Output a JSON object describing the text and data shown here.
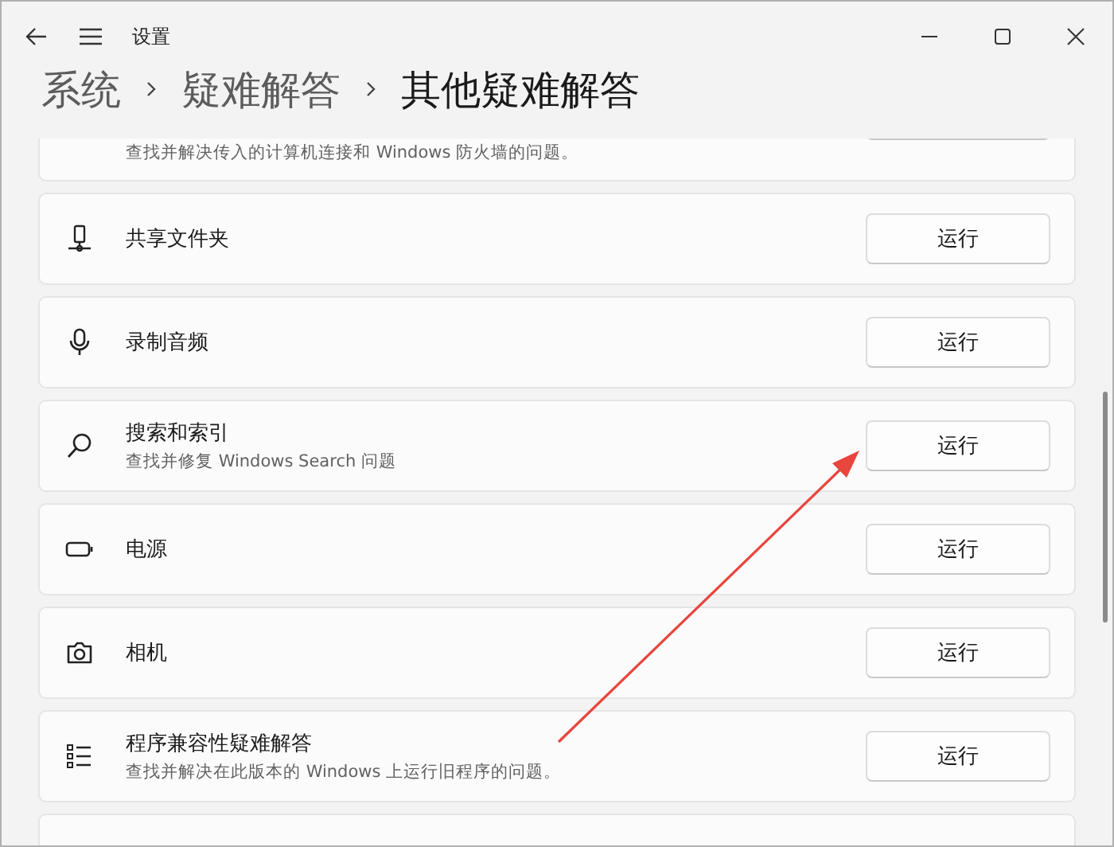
{
  "window": {
    "title": "设置"
  },
  "breadcrumb": [
    {
      "label": "系统",
      "current": false
    },
    {
      "label": "疑难解答",
      "current": false
    },
    {
      "label": "其他疑难解答",
      "current": true
    }
  ],
  "items": [
    {
      "description": "查找并解决传入的计算机连接和 Windows 防火墙的问题。"
    },
    {
      "title": "共享文件夹",
      "button": "运行"
    },
    {
      "title": "录制音频",
      "button": "运行"
    },
    {
      "title": "搜索和索引",
      "description": "查找并修复 Windows Search 问题",
      "button": "运行"
    },
    {
      "title": "电源",
      "button": "运行"
    },
    {
      "title": "相机",
      "button": "运行"
    },
    {
      "title": "程序兼容性疑难解答",
      "description": "查找并解决在此版本的 Windows 上运行旧程序的问题。",
      "button": "运行"
    }
  ]
}
